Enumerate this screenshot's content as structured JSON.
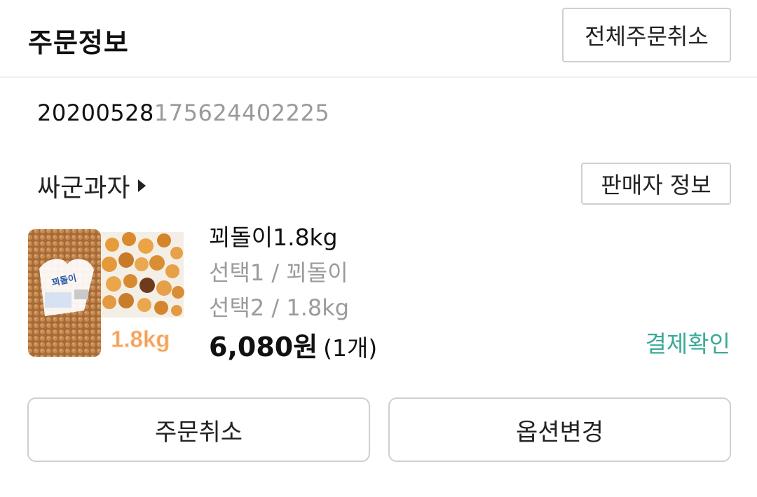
{
  "header": {
    "title": "주문정보",
    "cancel_all_label": "전체주문취소"
  },
  "order": {
    "number_main": "20200528",
    "number_suffix": "175624402225"
  },
  "seller": {
    "name": "싸군과자",
    "info_label": "판매자 정보"
  },
  "product": {
    "image_badge": "1.8kg",
    "name": "꾀돌이1.8kg",
    "option1": "선택1 / 꾀돌이",
    "option2": "선택2 / 1.8kg",
    "price": "6,080원",
    "quantity": "(1개)",
    "status": "결제확인"
  },
  "colors": {
    "status": "#3aaa99",
    "border": "#cfcfcf",
    "secondary_text": "#9b9b9b"
  },
  "actions": {
    "cancel_order_label": "주문취소",
    "change_option_label": "옵션변경"
  }
}
